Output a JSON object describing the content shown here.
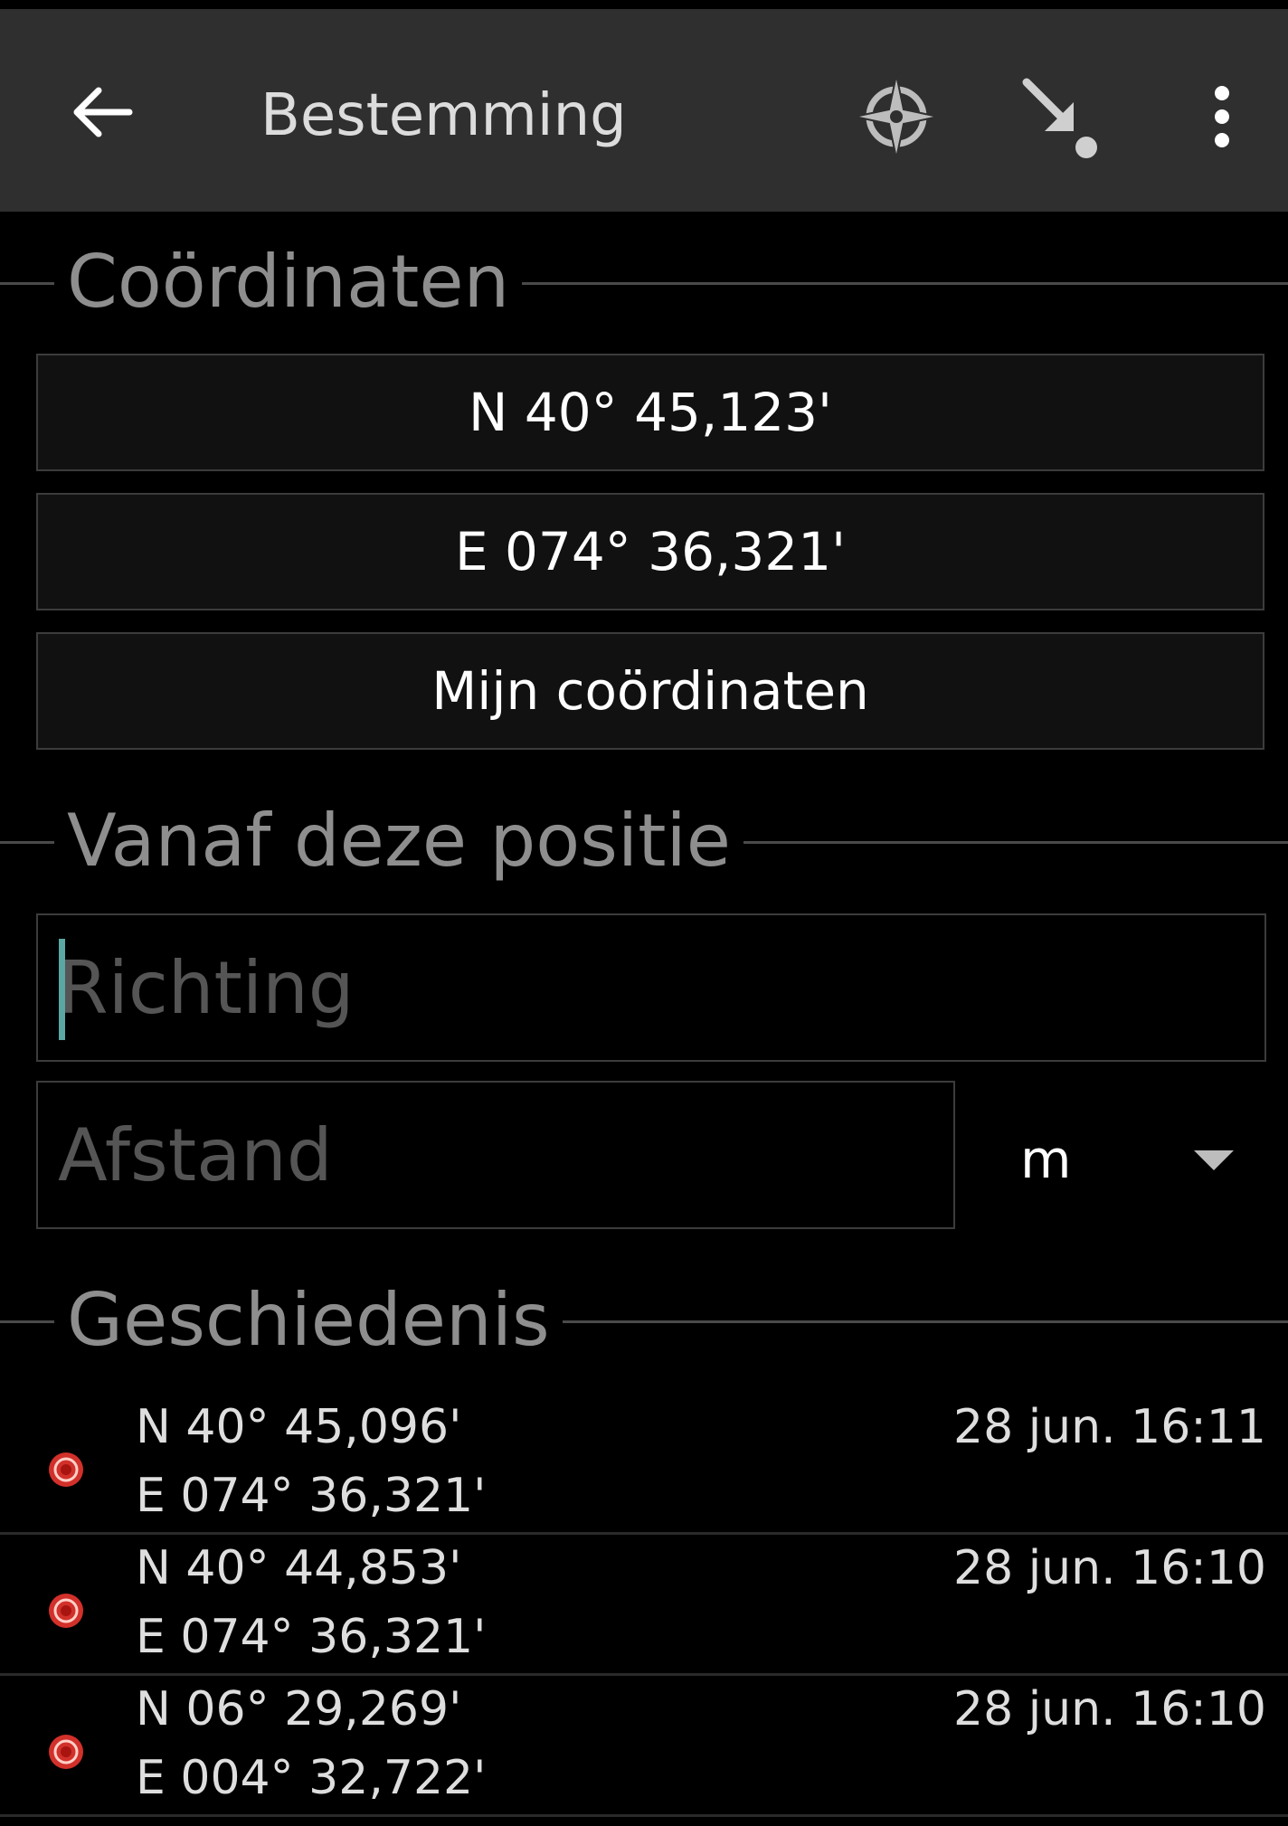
{
  "toolbar": {
    "title": "Bestemming",
    "back_icon": "arrow-left-icon",
    "compass_icon": "compass-icon",
    "goto_icon": "arrow-to-point-icon",
    "overflow_icon": "more-vertical-icon"
  },
  "sections": {
    "coordinates": "Coördinaten",
    "from_position": "Vanaf deze positie",
    "history": "Geschiedenis"
  },
  "coords": {
    "latitude": "N 40° 45,123'",
    "longitude": "E 074° 36,321'",
    "my_coordinates": "Mijn coördinaten"
  },
  "projection": {
    "bearing_placeholder": "Richting",
    "distance_placeholder": "Afstand",
    "unit": "m"
  },
  "history": [
    {
      "lat": "N 40° 45,096'",
      "lon": "E 074° 36,321'",
      "time": "28 jun. 16:11"
    },
    {
      "lat": "N 40° 44,853'",
      "lon": "E 074° 36,321'",
      "time": "28 jun. 16:10"
    },
    {
      "lat": "N 06° 29,269'",
      "lon": "E 004° 32,722'",
      "time": "28 jun. 16:10"
    }
  ],
  "colors": {
    "toolbar_bg": "#2f2f2f",
    "accent_cursor": "#5aa7a4",
    "pin_red": "#d2302a"
  }
}
